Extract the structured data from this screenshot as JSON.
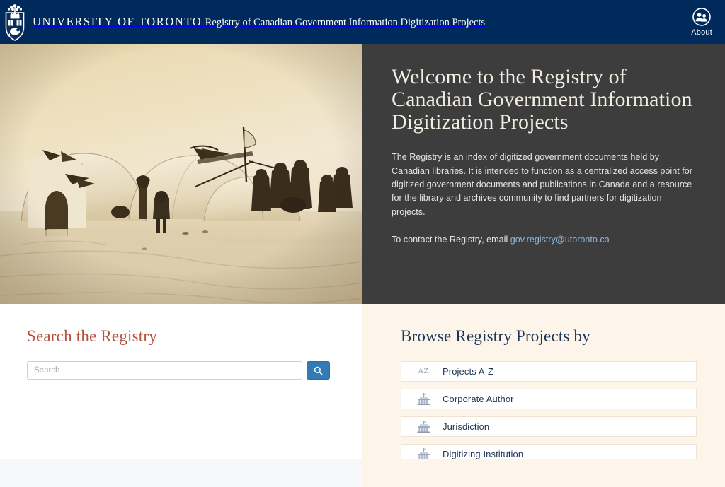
{
  "header": {
    "crest_icon": "uoft-crest-icon",
    "university_name": "UNIVERSITY OF  TORONTO",
    "site_name": "Registry of Canadian Government Information Digitization Projects",
    "about": {
      "label": "About",
      "icon": "people-circle-icon"
    },
    "background_color": "#002a5c"
  },
  "hero": {
    "photo": {
      "icon": "historic-igloo-camp-photo",
      "alt": "Sepia photograph of an Inuit snow-house (igloo) camp with figures standing on snow"
    },
    "title": "Welcome to the Registry of Canadian Government Information Digitization Projects",
    "paragraph": "The Registry is an index of digitized government documents held by Canadian libraries. It is intended to function as a centralized access point for digitized government documents and publications in Canada and a resource for the library and archives community to find partners for digitization projects.",
    "contact_prefix": "To contact the Registry, email",
    "contact_email": "gov.registry@utoronto.ca",
    "background_color": "#3d3d3d",
    "link_color": "#8ab8e0"
  },
  "search": {
    "title": "Search the Registry",
    "title_color": "#b4513f",
    "placeholder": "Search",
    "value": "",
    "button_icon": "search-icon",
    "button_color": "#337ab7"
  },
  "browse": {
    "title": "Browse Registry Projects by",
    "title_color": "#1d3557",
    "background_color": "#fdf4ea",
    "items": [
      {
        "label": "Projects A-Z",
        "icon": "az-icon",
        "glyph": "AZ"
      },
      {
        "label": "Corporate Author",
        "icon": "institution-icon",
        "glyph": ""
      },
      {
        "label": "Jurisdiction",
        "icon": "institution-icon",
        "glyph": ""
      },
      {
        "label": "Digitizing Institution",
        "icon": "institution-icon",
        "glyph": ""
      }
    ]
  },
  "footer": {
    "left_color": "#f6f8fa",
    "right_color": "#fdf4ea"
  }
}
